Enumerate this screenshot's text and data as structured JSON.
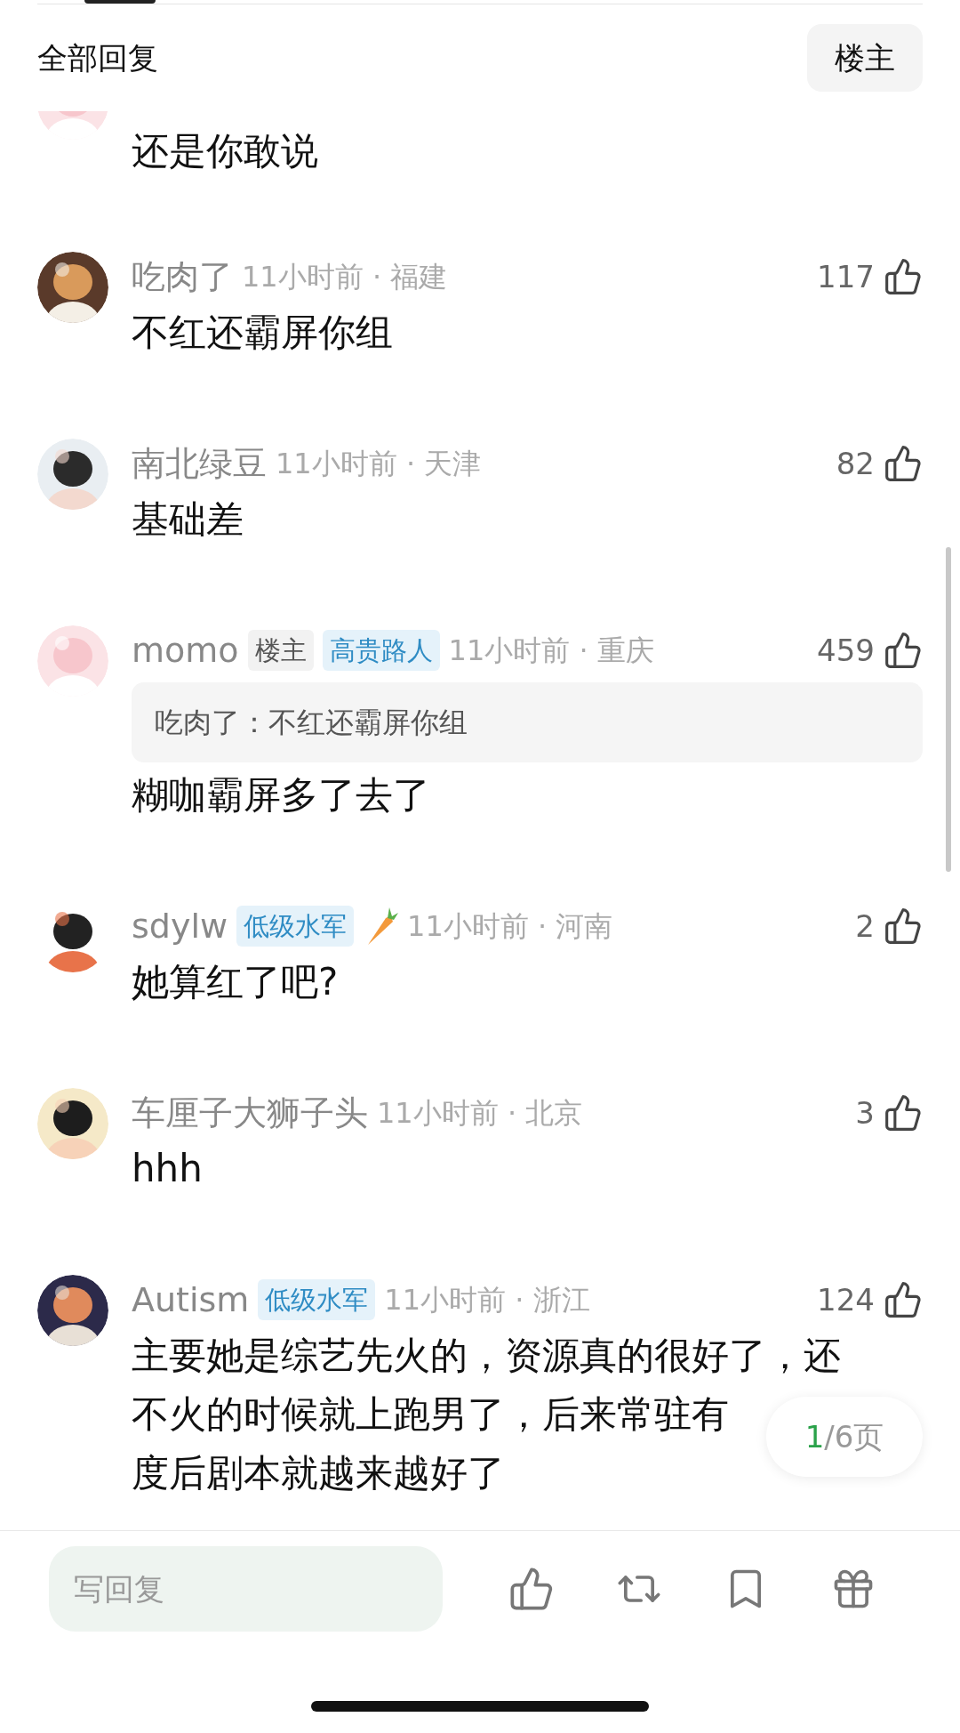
{
  "header": {
    "title": "全部回复",
    "filter_button": "楼主"
  },
  "comments": [
    {
      "kind": "partial",
      "lines": [
        "还是你敢说"
      ]
    },
    {
      "kind": "full",
      "name": "吃肉了",
      "has_pendant": false,
      "meta": "11小时前 · 福建",
      "likes": "117",
      "lines": [
        "不红还霸屏你组"
      ]
    },
    {
      "kind": "full",
      "name": "南北绿豆",
      "has_pendant": false,
      "meta": "11小时前 · 天津",
      "likes": "82",
      "lines": [
        "基础差"
      ]
    },
    {
      "kind": "full",
      "name": "momo",
      "badges": [
        {
          "text": "楼主",
          "kind": "owner"
        },
        {
          "text": "高贵路人",
          "kind": "title"
        }
      ],
      "has_pendant": false,
      "meta": "11小时前 · 重庆",
      "likes": "459",
      "quote": "吃肉了：不红还霸屏你组",
      "lines": [
        "糊咖霸屏多了去了"
      ]
    },
    {
      "kind": "full",
      "name": "sdylw",
      "badges": [
        {
          "text": "低级水军",
          "kind": "title"
        }
      ],
      "has_pendant": true,
      "meta": "11小时前 · 河南",
      "likes": "2",
      "lines": [
        "她算红了吧?"
      ]
    },
    {
      "kind": "full",
      "name": "车厘子大狮子头",
      "has_pendant": false,
      "meta": "11小时前 · 北京",
      "likes": "3",
      "lines": [
        "hhh"
      ]
    },
    {
      "kind": "full",
      "name": "Autism",
      "badges": [
        {
          "text": "低级水军",
          "kind": "title"
        }
      ],
      "has_pendant": false,
      "meta": "11小时前 · 浙江",
      "likes": "124",
      "lines": [
        "主要她是综艺先火的，资源真的很好了，还",
        "不火的时候就上跑男了，后来常驻有",
        "度后剧本就越来越好了"
      ]
    }
  ],
  "page_indicator": {
    "current": "1",
    "rest": "/6页"
  },
  "reply_bar": {
    "placeholder": "写回复"
  }
}
